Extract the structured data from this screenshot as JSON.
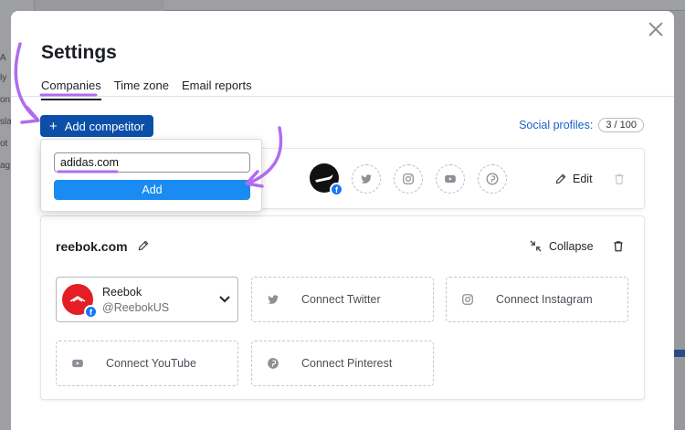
{
  "background": {
    "left_fragments": [
      "A",
      "ly",
      "on",
      "sla",
      "ot",
      "ag"
    ]
  },
  "modal": {
    "title": "Settings",
    "tabs": [
      {
        "label": "Companies",
        "active": true
      },
      {
        "label": "Time zone",
        "active": false
      },
      {
        "label": "Email reports",
        "active": false
      }
    ],
    "add_competitor_label": "Add competitor",
    "social_profiles_label": "Social profiles:",
    "social_profiles_count": "3 / 100"
  },
  "popover": {
    "input_value": "adidas.com",
    "add_label": "Add"
  },
  "card1": {
    "edit_label": "Edit"
  },
  "card2": {
    "domain": "reebok.com",
    "collapse_label": "Collapse",
    "profile": {
      "name": "Reebok",
      "handle": "@ReebokUS"
    },
    "connect": {
      "twitter": "Connect Twitter",
      "instagram": "Connect Instagram",
      "youtube": "Connect YouTube",
      "pinterest": "Connect Pinterest"
    }
  },
  "colors": {
    "primary_button": "#0b4fa8",
    "add_button": "#1a8bf2",
    "link": "#1a60c7",
    "annotation": "#b06cf0",
    "facebook": "#1877f2",
    "reebok_red": "#e31e24"
  }
}
